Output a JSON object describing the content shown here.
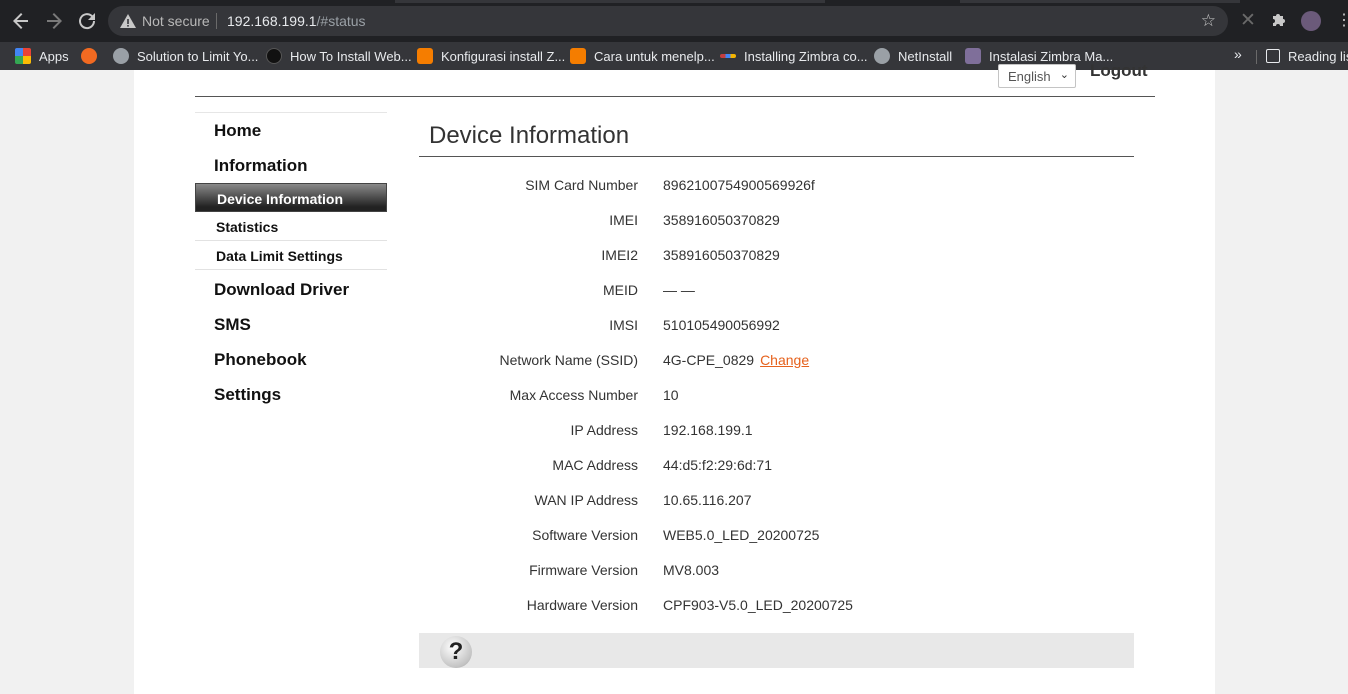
{
  "browser": {
    "security_text": "Not secure",
    "url_host": "192.168.199.1",
    "url_path": "/#status",
    "bookmarks": [
      {
        "label": "Apps",
        "color": "#ea4335"
      },
      {
        "label": "Solution to Limit Yo...",
        "color": "#9aa0a6"
      },
      {
        "label": "How To Install Web...",
        "color": "#111111"
      },
      {
        "label": "Konfigurasi install Z...",
        "color": "#f57d00"
      },
      {
        "label": "Cara untuk menelp...",
        "color": "#f57d00"
      },
      {
        "label": "Installing Zimbra co...",
        "color": "#c43f3f"
      },
      {
        "label": "NetInstall",
        "color": "#9aa0a6"
      },
      {
        "label": "Instalasi Zimbra Ma...",
        "color": "#7f6f9a"
      }
    ],
    "reading_list": "Reading list"
  },
  "header": {
    "language": "English",
    "logout": "Logout"
  },
  "sidebar": {
    "home": "Home",
    "information": "Information",
    "sub": [
      "Device Information",
      "Statistics",
      "Data Limit Settings"
    ],
    "download_driver": "Download Driver",
    "sms": "SMS",
    "phonebook": "Phonebook",
    "settings": "Settings"
  },
  "main": {
    "title": "Device Information",
    "rows": [
      {
        "label": "SIM Card Number",
        "value": "8962100754900569926f"
      },
      {
        "label": "IMEI",
        "value": "358916050370829"
      },
      {
        "label": "IMEI2",
        "value": "358916050370829"
      },
      {
        "label": "MEID",
        "value": "— —"
      },
      {
        "label": "IMSI",
        "value": "510105490056992"
      },
      {
        "label": "Network Name (SSID)",
        "value": "4G-CPE_0829"
      },
      {
        "label": "Max Access Number",
        "value": "10"
      },
      {
        "label": "IP Address",
        "value": "192.168.199.1"
      },
      {
        "label": "MAC Address",
        "value": "44:d5:f2:29:6d:71"
      },
      {
        "label": "WAN IP Address",
        "value": "10.65.116.207"
      },
      {
        "label": "Software Version",
        "value": "WEB5.0_LED_20200725"
      },
      {
        "label": "Firmware Version",
        "value": "MV8.003"
      },
      {
        "label": "Hardware Version",
        "value": "CPF903-V5.0_LED_20200725"
      }
    ],
    "change_link": "Change",
    "help_symbol": "?"
  },
  "colors": {
    "accent_link": "#e6621d",
    "chrome_dark": "#202124",
    "toolbar": "#35363a"
  }
}
